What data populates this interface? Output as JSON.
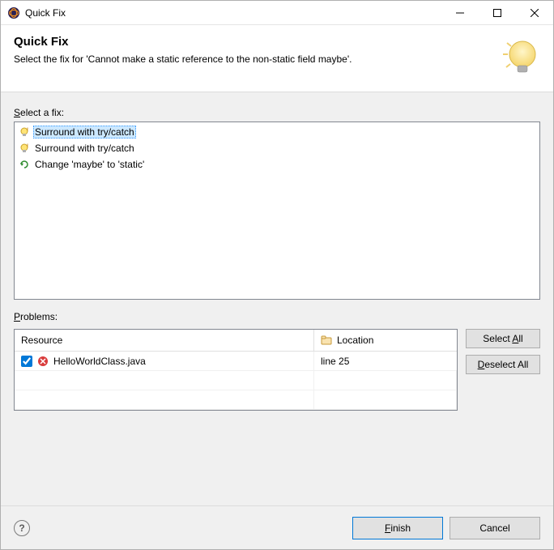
{
  "window": {
    "title": "Quick Fix"
  },
  "header": {
    "title": "Quick Fix",
    "subtitle": "Select the fix for 'Cannot make a static reference to the non-static field maybe'."
  },
  "labels": {
    "select_fix_prefix": "S",
    "select_fix_rest": "elect a fix:",
    "problems_prefix": "P",
    "problems_rest": "roblems:"
  },
  "fixes": [
    {
      "label": "Surround with try/catch",
      "icon": "lightbulb",
      "selected": true
    },
    {
      "label": "Surround with try/catch",
      "icon": "lightbulb",
      "selected": false
    },
    {
      "label": "Change 'maybe' to 'static'",
      "icon": "change",
      "selected": false
    }
  ],
  "table": {
    "headers": {
      "resource": "Resource",
      "location": "Location"
    },
    "rows": [
      {
        "checked": true,
        "resource": "HelloWorldClass.java",
        "location": "line 25"
      }
    ]
  },
  "buttons": {
    "select_all": "Select All",
    "select_all_ul": "A",
    "deselect_all": "Deselect All",
    "deselect_all_ul": "D",
    "finish": "Finish",
    "finish_ul": "F",
    "cancel": "Cancel"
  }
}
